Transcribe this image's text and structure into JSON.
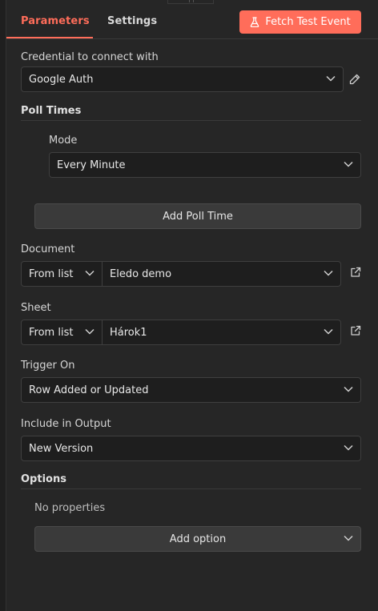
{
  "tabs": [
    {
      "label": "Parameters",
      "active": true
    },
    {
      "label": "Settings",
      "active": false
    }
  ],
  "fetch_button": {
    "label": "Fetch Test Event",
    "icon": "flask-icon"
  },
  "credential": {
    "label": "Credential to connect with",
    "value": "Google Auth",
    "edit_icon": "pencil-icon"
  },
  "poll_times": {
    "title": "Poll Times",
    "mode_label": "Mode",
    "mode_value": "Every Minute",
    "add_button": "Add Poll Time"
  },
  "document": {
    "label": "Document",
    "source": "From list",
    "value": "Eledo demo",
    "link_icon": "external-link-icon"
  },
  "sheet": {
    "label": "Sheet",
    "source": "From list",
    "value": "Hárok1",
    "link_icon": "external-link-icon"
  },
  "trigger_on": {
    "label": "Trigger On",
    "value": "Row Added or Updated"
  },
  "include_output": {
    "label": "Include in Output",
    "value": "New Version"
  },
  "options": {
    "title": "Options",
    "empty_text": "No properties",
    "add_button": "Add option"
  },
  "colors": {
    "accent": "#ff6d5a",
    "background": "#262626",
    "input": "#1e1e1e",
    "button": "#3a3a3a"
  }
}
